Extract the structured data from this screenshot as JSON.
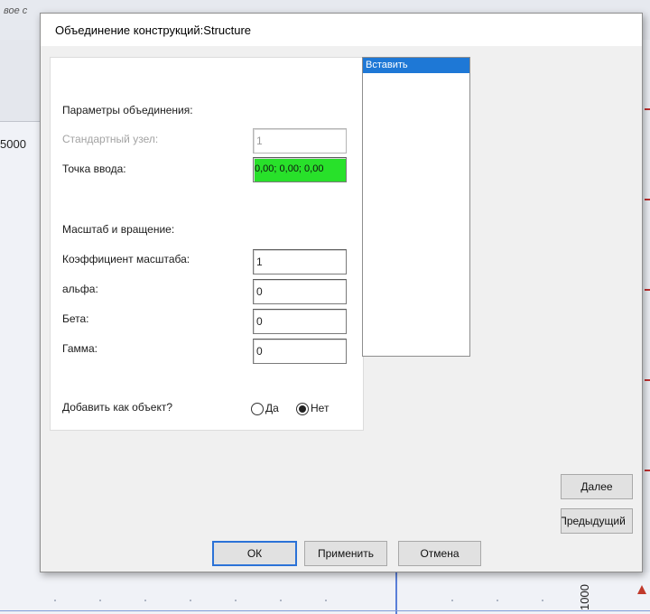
{
  "background": {
    "topbar_text": "вое с",
    "scale_left": "5000",
    "scale_right": "1000"
  },
  "dialog": {
    "title": "Объединение конструкций:Structure",
    "section_merge": "Параметры объединения:",
    "standard_node_label": "Стандартный узел:",
    "standard_node_value": "1",
    "insert_point_label": "Точка ввода:",
    "insert_point_value": "0,00; 0,00; 0,00",
    "section_scale": "Масштаб и вращение:",
    "scale_factor_label": "Коэффициент масштаба:",
    "scale_factor_value": "1",
    "alpha_label": "альфа:",
    "alpha_value": "0",
    "beta_label": "Бета:",
    "beta_value": "0",
    "gamma_label": "Гамма:",
    "gamma_value": "0",
    "add_as_object_label": "Добавить как объект?",
    "radio_yes": "Да",
    "radio_no": "Нет",
    "radio_selected": "Нет",
    "list_items": [
      "Вставить"
    ],
    "next_button": "Далее",
    "prev_button": "Предыдущий",
    "ok_button": "ОК",
    "apply_button": "Применить",
    "cancel_button": "Отмена"
  },
  "colors": {
    "insert_point_bg": "#28e12a",
    "selection": "#1e78d6",
    "default_button_border": "#2b72d7"
  }
}
